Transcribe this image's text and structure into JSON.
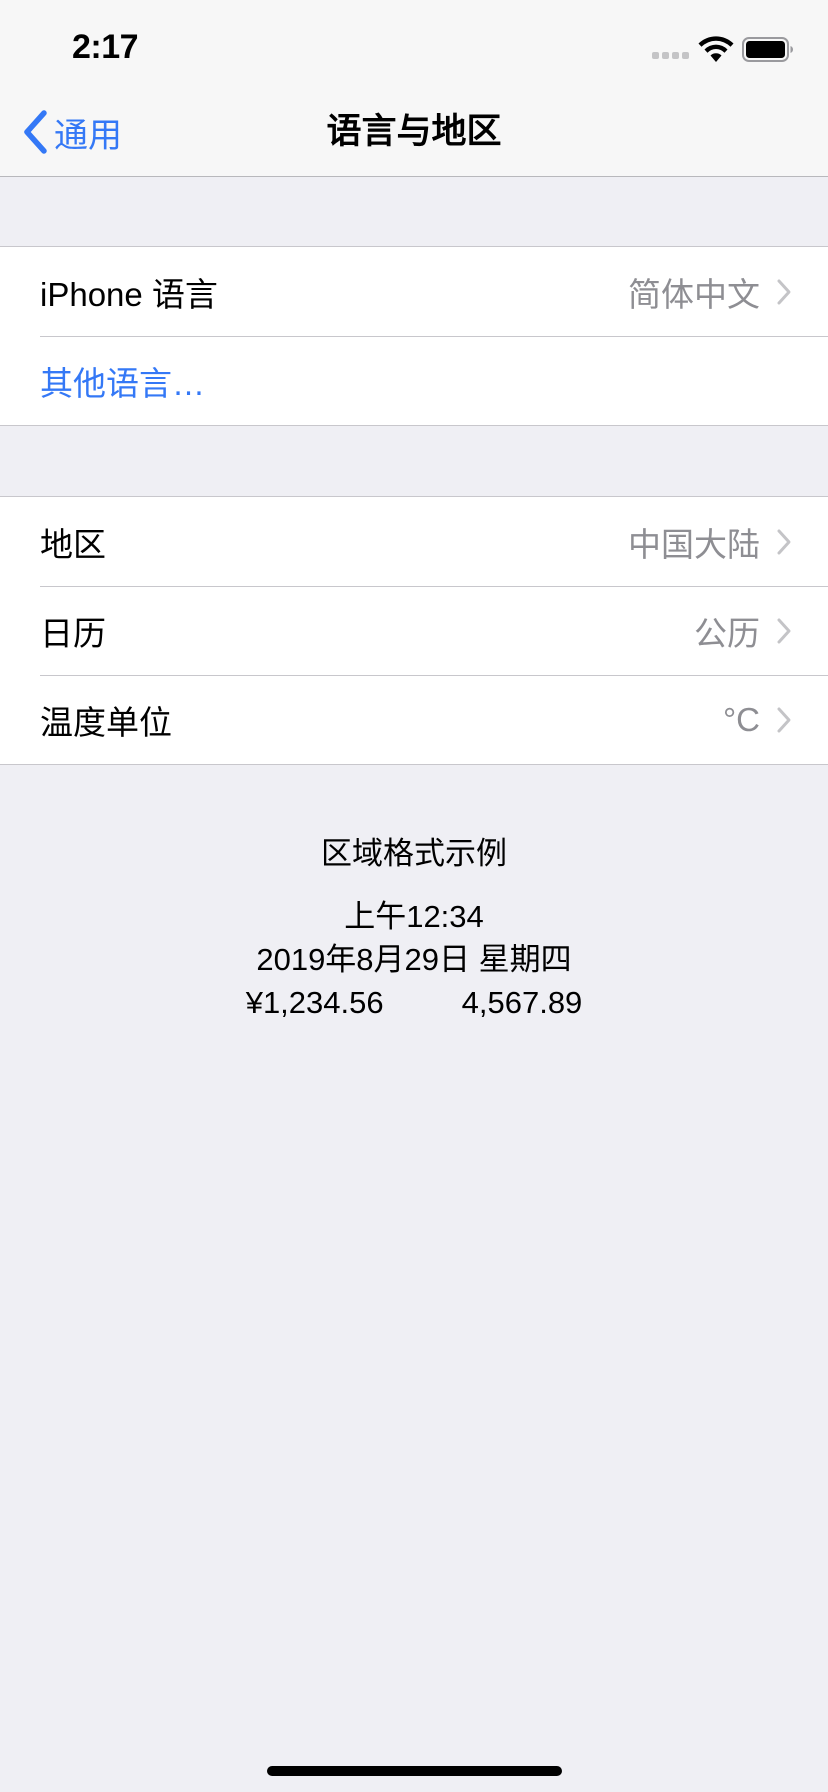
{
  "status_bar": {
    "time": "2:17",
    "icons": [
      "cellular-signal-icon",
      "wifi-icon",
      "battery-icon"
    ]
  },
  "nav": {
    "back_label": "通用",
    "back_icon": "chevron-left-icon",
    "title": "语言与地区"
  },
  "language_group": [
    {
      "title": "iPhone 语言",
      "value": "简体中文",
      "chevron": true
    },
    {
      "title": "其他语言…",
      "link": true
    }
  ],
  "region_group": [
    {
      "title": "地区",
      "value": "中国大陆",
      "chevron": true
    },
    {
      "title": "日历",
      "value": "公历",
      "chevron": true
    },
    {
      "title": "温度单位",
      "value": "°C",
      "chevron": true
    }
  ],
  "format_example": {
    "heading": "区域格式示例",
    "time": "上午12:34",
    "date": "2019年8月29日 星期四",
    "currency": "¥1,234.56",
    "number": "4,567.89"
  },
  "colors": {
    "accent": "#3478f6",
    "secondary_text": "#8e8e93",
    "background": "#efeff4"
  }
}
